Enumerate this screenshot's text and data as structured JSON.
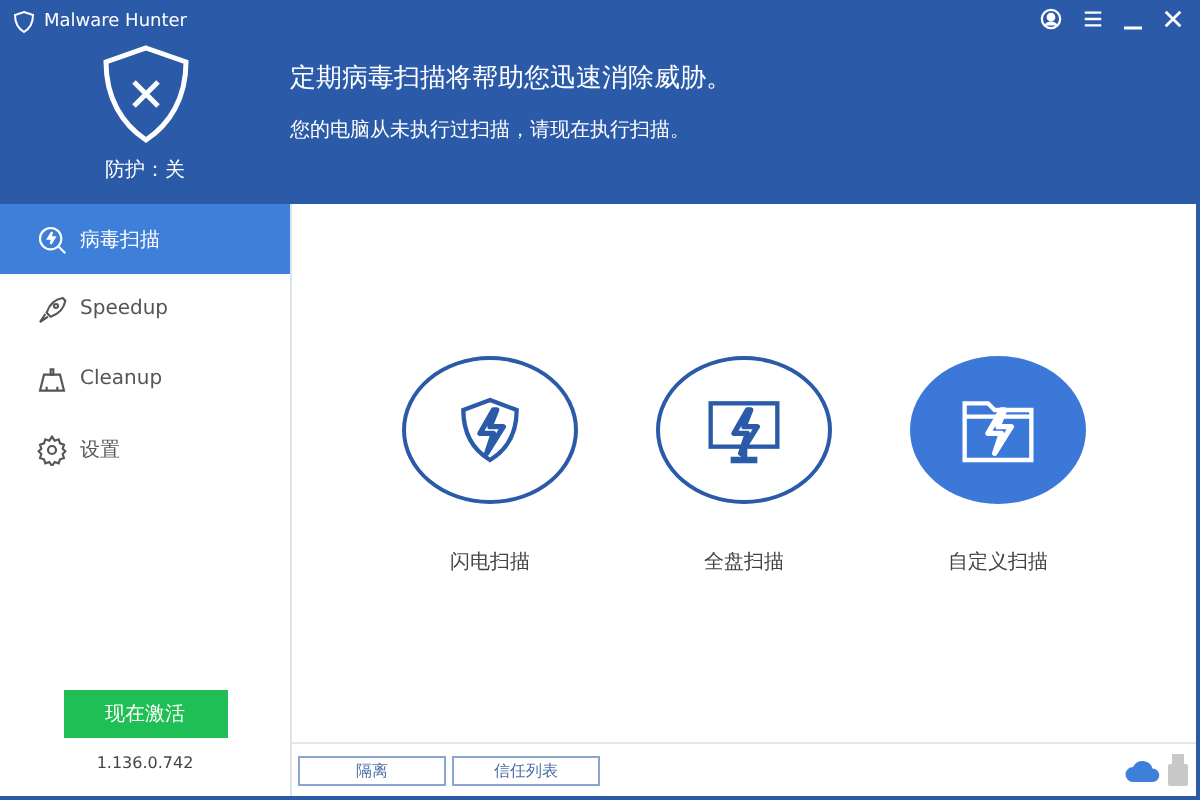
{
  "window": {
    "title": "Malware Hunter"
  },
  "protection": {
    "status": "防护：关",
    "on": false
  },
  "header": {
    "headline": "定期病毒扫描将帮助您迅速消除威胁。",
    "subtext": "您的电脑从未执行过扫描，请现在执行扫描。"
  },
  "sidebar": {
    "items": [
      {
        "kind": "scan",
        "label": "病毒扫描",
        "selected": true
      },
      {
        "kind": "speedup",
        "label": "Speedup",
        "selected": false
      },
      {
        "kind": "cleanup",
        "label": "Cleanup",
        "selected": false
      },
      {
        "kind": "settings",
        "label": "设置",
        "selected": false
      }
    ],
    "activate_button": "现在激活",
    "version": "1.136.0.742"
  },
  "scan_options": [
    {
      "kind": "quick",
      "label": "闪电扫描",
      "selected": false
    },
    {
      "kind": "full",
      "label": "全盘扫描",
      "selected": false
    },
    {
      "kind": "custom",
      "label": "自定义扫描",
      "selected": true
    }
  ],
  "footer_buttons": [
    "隔离",
    "信任列表"
  ]
}
